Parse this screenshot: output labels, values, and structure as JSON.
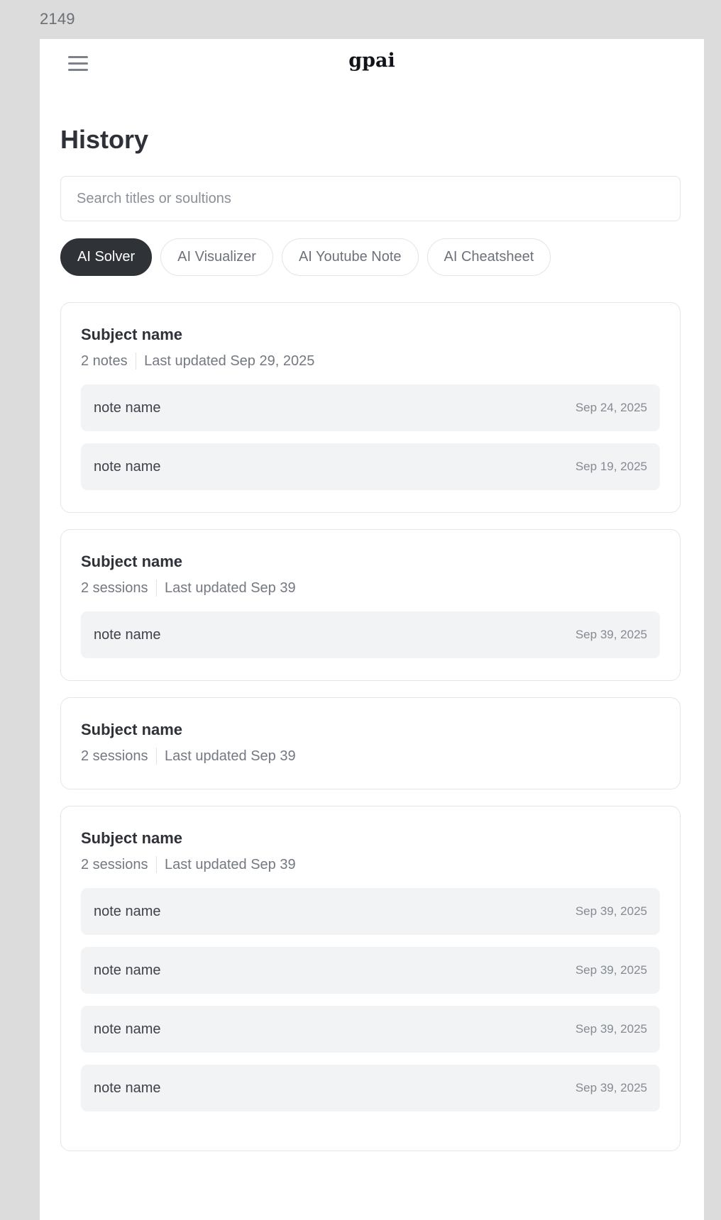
{
  "frame_label": "2149",
  "header": {
    "brand": "gpai",
    "menu_icon": "hamburger-menu-icon"
  },
  "page_title": "History",
  "search": {
    "placeholder": "Search titles or soultions",
    "value": ""
  },
  "tabs": [
    {
      "label": "AI Solver",
      "active": true
    },
    {
      "label": "AI Visualizer",
      "active": false
    },
    {
      "label": "AI Youtube Note",
      "active": false
    },
    {
      "label": "AI Cheatsheet",
      "active": false
    }
  ],
  "colors": {
    "active_tab_bg": "#2f3237",
    "note_bg": "#f2f3f5",
    "border": "#e3e5e8"
  },
  "subjects": [
    {
      "title": "Subject name",
      "count": "2 notes",
      "updated": "Last updated Sep 29, 2025",
      "notes": [
        {
          "name": "note name",
          "date": "Sep 24, 2025"
        },
        {
          "name": "note name",
          "date": "Sep 19, 2025"
        }
      ]
    },
    {
      "title": "Subject name",
      "count": "2 sessions",
      "updated": "Last updated Sep 39",
      "notes": [
        {
          "name": "note name",
          "date": "Sep 39, 2025"
        }
      ]
    },
    {
      "title": "Subject name",
      "count": "2 sessions",
      "updated": "Last updated Sep 39",
      "notes": []
    },
    {
      "title": "Subject name",
      "count": "2 sessions",
      "updated": "Last updated Sep 39",
      "notes": [
        {
          "name": "note name",
          "date": "Sep 39, 2025"
        },
        {
          "name": "note name",
          "date": "Sep 39, 2025"
        },
        {
          "name": "note name",
          "date": "Sep 39, 2025"
        },
        {
          "name": "note name",
          "date": "Sep 39, 2025"
        }
      ]
    }
  ]
}
